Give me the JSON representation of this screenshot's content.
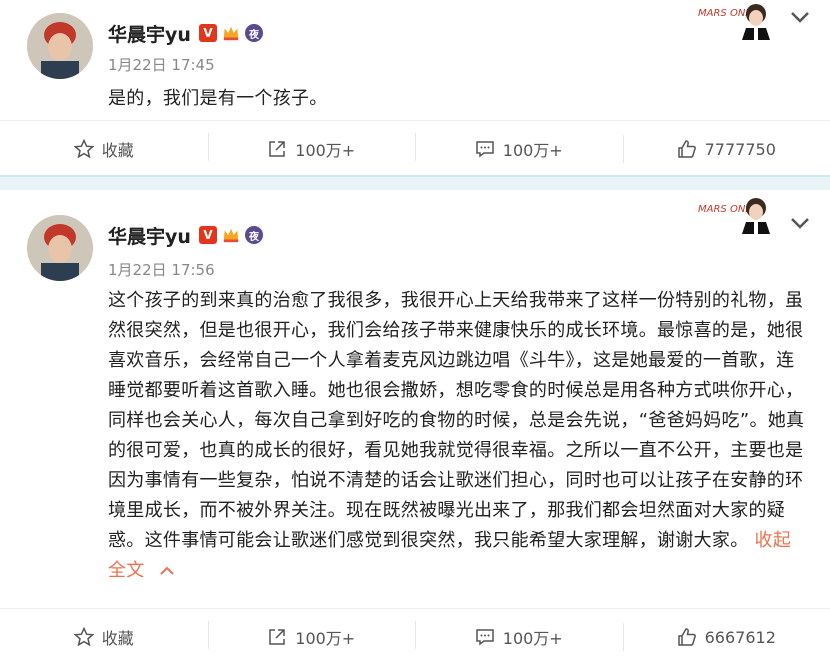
{
  "posts": [
    {
      "user": {
        "name": "华晨宇yu",
        "badge_v": "V",
        "badge_night": "夜"
      },
      "time": "1月22日 17:45",
      "content": "是的，我们是有一个孩子。",
      "actions": {
        "collect": "收藏",
        "repost": "100万+",
        "comment": "100万+",
        "like": "7777750"
      }
    },
    {
      "user": {
        "name": "华晨宇yu",
        "badge_v": "V",
        "badge_night": "夜"
      },
      "time": "1月22日 17:56",
      "content": "这个孩子的到来真的治愈了我很多，我很开心上天给我带来了这样一份特别的礼物，虽然很突然，但是也很开心，我们会给孩子带来健康快乐的成长环境。最惊喜的是，她很喜欢音乐，会经常自己一个人拿着麦克风边跳边唱《斗牛》，这是她最爱的一首歌，连睡觉都要听着这首歌入睡。她也很会撒娇，想吃零食的时候总是用各种方式哄你开心，同样也会关心人，每次自己拿到好吃的食物的时候，总是会先说，“爸爸妈妈吃”。她真的很可爱，也真的成长的很好，看见她我就觉得很幸福。之所以一直不公开，主要也是因为事情有一些复杂，怕说不清楚的话会让歌迷们担心，同时也可以让孩子在安静的环境里成长，而不被外界关注。现在既然被曝光出来了，那我们都会坦然面对大家的疑惑。这件事情可能会让歌迷们感觉到很突然，我只能希望大家理解，谢谢大家。",
      "collapse": "收起全文",
      "actions": {
        "collect": "收藏",
        "repost": "100万+",
        "comment": "100万+",
        "like": "6667612"
      }
    }
  ],
  "sticker_text": "MARS ONES",
  "colors": {
    "accent": "#eb7350",
    "badge_v": "#e2361c",
    "separator": "#e9f3f8"
  }
}
